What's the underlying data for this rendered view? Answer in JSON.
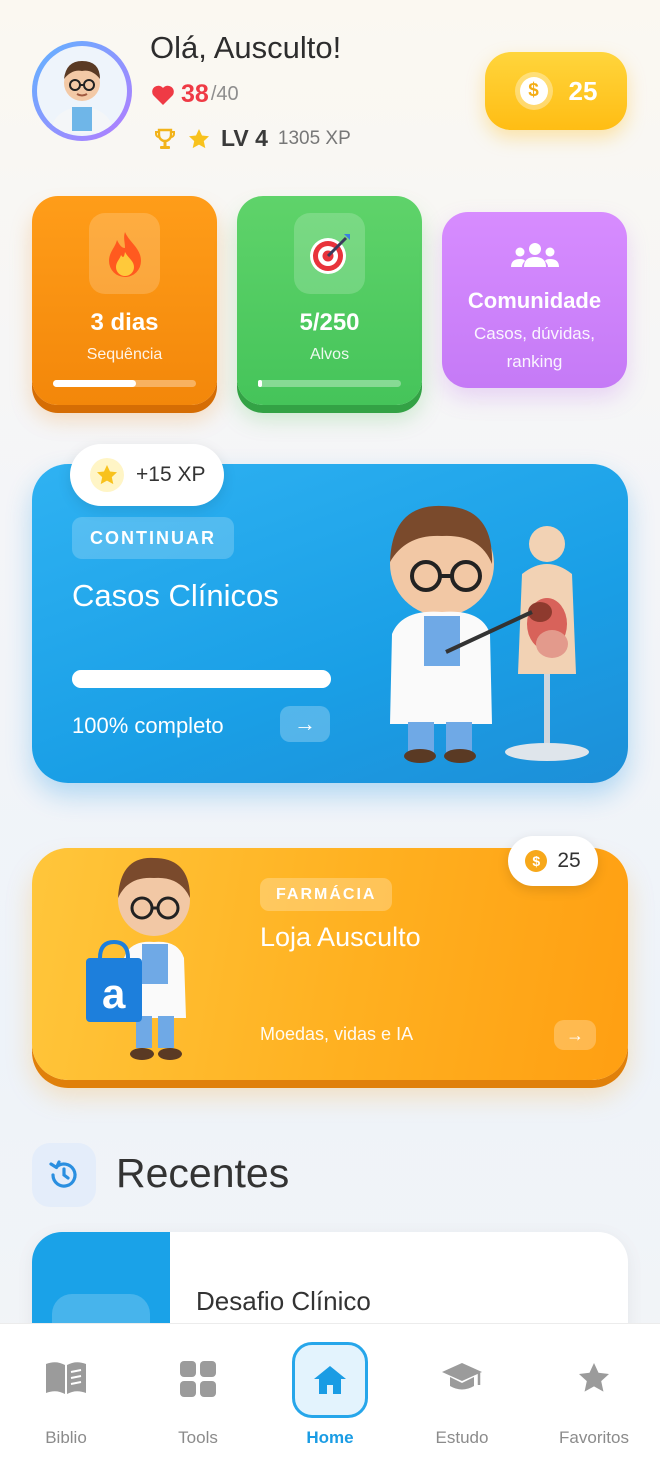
{
  "header": {
    "greeting": "Olá, Ausculto!",
    "lives_current": "38",
    "lives_max": "/40",
    "level": "LV 4",
    "xp": "1305 XP",
    "coins": "25"
  },
  "stats": {
    "streak": {
      "value": "3 dias",
      "label": "Sequência",
      "progress": 0.58
    },
    "targets": {
      "value": "5/250",
      "label": "Alvos",
      "progress": 0.02
    },
    "community": {
      "title": "Comunidade",
      "subtitle": "Casos, dúvidas, ranking"
    }
  },
  "continue_card": {
    "xp_badge": "+15 XP",
    "tag": "CONTINUAR",
    "title": "Casos Clínicos",
    "progress": 1.0,
    "progress_text": "100% completo"
  },
  "shop_card": {
    "coin_badge": "25",
    "tag": "FARMÁCIA",
    "title": "Loja Ausculto",
    "subtitle": "Moedas, vidas e IA"
  },
  "recents": {
    "title": "Recentes",
    "items": [
      {
        "name": "Desafio Clínico"
      }
    ]
  },
  "nav": {
    "items": [
      {
        "label": "Biblio",
        "icon": "book-icon"
      },
      {
        "label": "Tools",
        "icon": "grid-icon"
      },
      {
        "label": "Home",
        "icon": "home-icon"
      },
      {
        "label": "Estudo",
        "icon": "graduation-cap-icon"
      },
      {
        "label": "Favoritos",
        "icon": "star-icon"
      }
    ],
    "active": "Home"
  },
  "colors": {
    "accent_blue": "#1a9ce4",
    "streak_orange": "#f3870a",
    "targets_green": "#45c45a",
    "community_purple": "#c57af6",
    "shop_orange": "#ffb020",
    "heart_red": "#ef3a45"
  }
}
